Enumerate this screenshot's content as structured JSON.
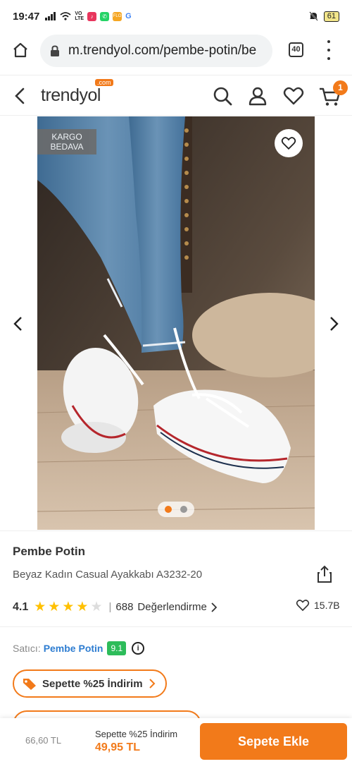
{
  "status_bar": {
    "time": "19:47",
    "battery": "61"
  },
  "browser": {
    "url": "m.trendyol.com/pembe-potin/be",
    "tab_count": "40"
  },
  "header": {
    "logo": "trendyol",
    "logo_badge": ".com",
    "cart_count": "1"
  },
  "gallery": {
    "badge_line1": "KARGO",
    "badge_line2": "BEDAVA",
    "image_count": 2,
    "active_index": 0
  },
  "product": {
    "brand": "Pembe Potin",
    "name": "Beyaz Kadın Casual Ayakkabı A3232-20",
    "rating": "4.1",
    "stars_filled": 4,
    "review_count": "688",
    "review_label": "Değerlendirme",
    "favorite_count": "15.7B"
  },
  "seller": {
    "label": "Satıcı:",
    "name": "Pembe Potin",
    "score": "9.1"
  },
  "promotions": [
    {
      "label": "Sepette %25 İndirim"
    }
  ],
  "bottom_bar": {
    "old_price": "66,60 TL",
    "promo_text": "Sepette %25 İndirim",
    "new_price": "49,95 TL",
    "cta_label": "Sepete Ekle"
  },
  "colors": {
    "brand_orange": "#f27a1a",
    "star_yellow": "#ffc000",
    "seller_link": "#2e7dd1",
    "score_green": "#2dbc5a"
  }
}
